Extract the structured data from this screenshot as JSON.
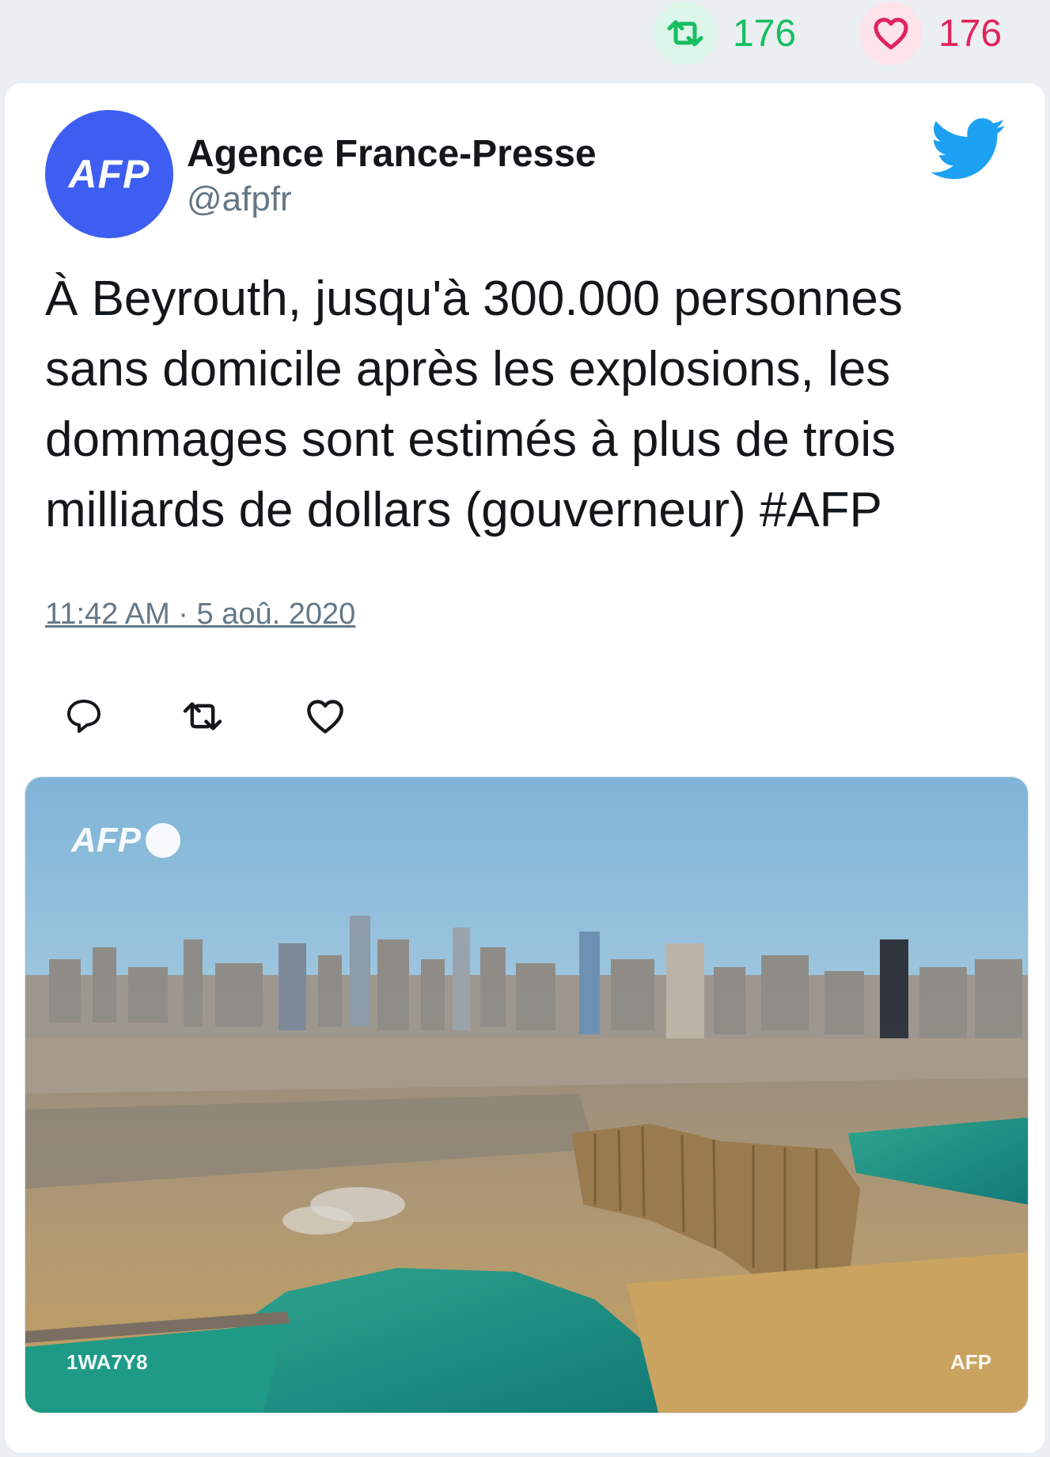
{
  "top_stats": {
    "retweets": "176",
    "likes": "176"
  },
  "tweet": {
    "author_name": "Agence France-Presse",
    "author_handle": "@afpfr",
    "avatar_text": "AFP",
    "text": "À Beyrouth, jusqu'à 300.000 personnes sans domicile après les explosions, les dommages sont estimés à plus de trois milliards de dollars (gouverneur) #AFP",
    "timestamp": "11:42 AM · 5 aoû. 2020"
  },
  "media": {
    "watermark_logo": "AFP",
    "image_id": "1WA7Y8",
    "credit": "AFP"
  },
  "icons": {
    "retweet": "retweet-icon",
    "like": "heart-icon",
    "reply": "reply-icon",
    "brand": "twitter-bird-icon"
  },
  "colors": {
    "retweet": "#17bf63",
    "like": "#e0245e",
    "avatar_bg": "#3d5ef0",
    "twitter_blue": "#1da1f2"
  }
}
